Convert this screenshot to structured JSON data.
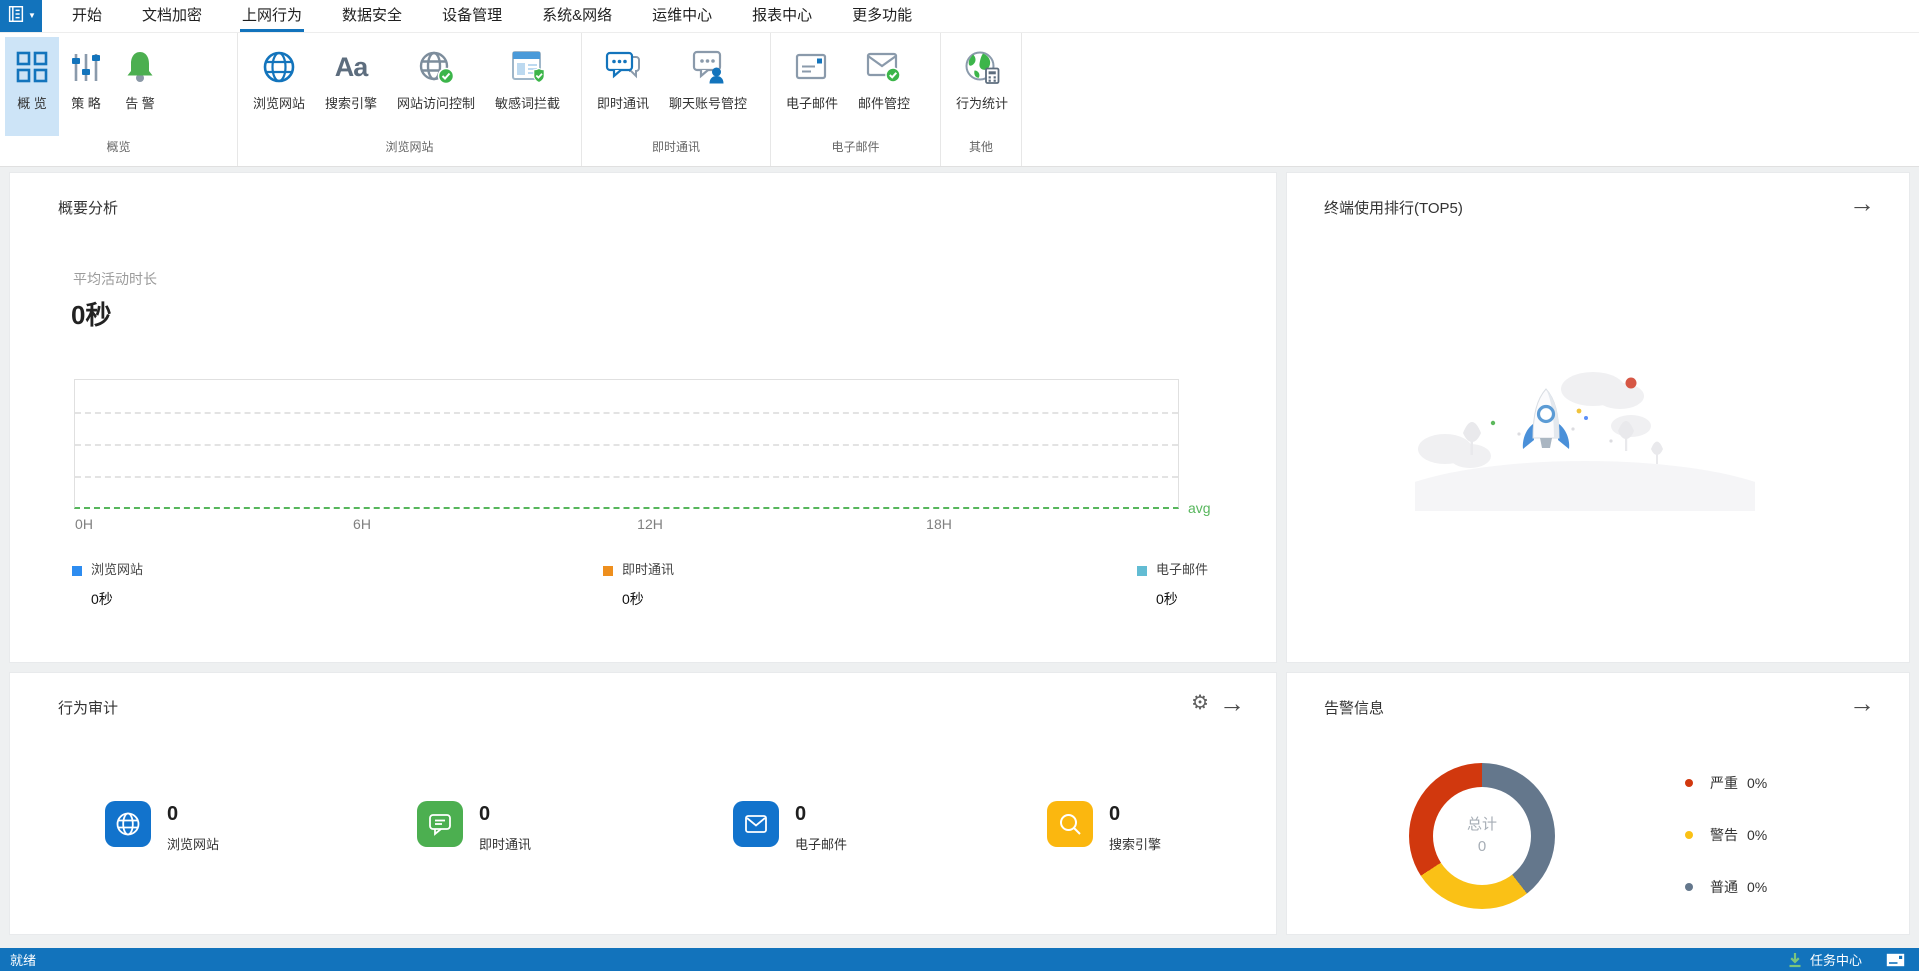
{
  "window": {
    "menu": [
      "开始",
      "文档加密",
      "上网行为",
      "数据安全",
      "设备管理",
      "系统&网络",
      "运维中心",
      "报表中心",
      "更多功能"
    ],
    "active_menu": "上网行为"
  },
  "ribbon": {
    "groups": [
      {
        "label": "概览",
        "buttons": [
          {
            "label": "概 览",
            "icon": "grid-icon",
            "selected": true
          },
          {
            "label": "策 略",
            "icon": "sliders-icon"
          },
          {
            "label": "告 警",
            "icon": "bell-icon"
          }
        ]
      },
      {
        "label": "浏览网站",
        "buttons": [
          {
            "label": "浏览网站",
            "icon": "globe-icon"
          },
          {
            "label": "搜索引擎",
            "icon": "aa-icon"
          },
          {
            "label": "网站访问控制",
            "icon": "globe-check-icon"
          },
          {
            "label": "敏感词拦截",
            "icon": "document-shield-icon"
          }
        ]
      },
      {
        "label": "即时通讯",
        "buttons": [
          {
            "label": "即时通讯",
            "icon": "chat-icon"
          },
          {
            "label": "聊天账号管控",
            "icon": "chat-person-icon"
          }
        ]
      },
      {
        "label": "电子邮件",
        "buttons": [
          {
            "label": "电子邮件",
            "icon": "mail-icon"
          },
          {
            "label": "邮件管控",
            "icon": "mail-shield-icon"
          }
        ]
      },
      {
        "label": "其他",
        "buttons": [
          {
            "label": "行为统计",
            "icon": "globe-calculator-icon"
          }
        ]
      }
    ]
  },
  "overview": {
    "title": "概要分析",
    "metric_label": "平均活动时长",
    "metric_value": "0秒",
    "x_labels": [
      "0H",
      "6H",
      "12H",
      "18H"
    ],
    "avg_label": "avg",
    "legend": [
      {
        "label": "浏览网站",
        "value": "0秒",
        "color": "#2d8cf0"
      },
      {
        "label": "即时通讯",
        "value": "0秒",
        "color": "#ee8f1e"
      },
      {
        "label": "电子邮件",
        "value": "0秒",
        "color": "#62bcd3"
      }
    ]
  },
  "top5": {
    "title": "终端使用排行(TOP5)",
    "arrow": "→"
  },
  "audit": {
    "title": "行为审计",
    "gear": "⚙",
    "arrow": "→",
    "items": [
      {
        "value": "0",
        "label": "浏览网站",
        "color": "#1273cc",
        "icon": "globe-icon"
      },
      {
        "value": "0",
        "label": "即时通讯",
        "color": "#4caf50",
        "icon": "chat-icon"
      },
      {
        "value": "0",
        "label": "电子邮件",
        "color": "#1273cc",
        "icon": "mail-icon"
      },
      {
        "value": "0",
        "label": "搜索引擎",
        "color": "#fbb70f",
        "icon": "search-icon"
      }
    ]
  },
  "alerts": {
    "title": "告警信息",
    "arrow": "→",
    "center_label": "总计",
    "center_value": "0"
  },
  "statusbar": {
    "left": "就绪",
    "task_center": "任务中心"
  },
  "chart_data": [
    {
      "type": "line",
      "title": "概要分析 - 平均活动时长",
      "x_axis_labels": [
        "0H",
        "6H",
        "12H",
        "18H"
      ],
      "x_range_hours": [
        0,
        23
      ],
      "series": [
        {
          "name": "浏览网站",
          "values": [
            0,
            0,
            0,
            0
          ],
          "color": "#2d8cf0"
        },
        {
          "name": "即时通讯",
          "values": [
            0,
            0,
            0,
            0
          ],
          "color": "#ee8f1e"
        },
        {
          "name": "电子邮件",
          "values": [
            0,
            0,
            0,
            0
          ],
          "color": "#62bcd3"
        }
      ],
      "avg_line": {
        "label": "avg",
        "value": 0,
        "color": "#57b65c",
        "style": "dashed"
      },
      "grid": "dashed-horizontal",
      "legend_position": "bottom"
    },
    {
      "type": "pie",
      "donut": true,
      "title": "告警信息",
      "center_label": "总计",
      "center_value": 0,
      "slices": [
        {
          "label": "严重",
          "percent_label": "0%",
          "color": "#d1380e",
          "display_angle_deg": 123
        },
        {
          "label": "警告",
          "percent_label": "0%",
          "color": "#fac116",
          "display_angle_deg": 95
        },
        {
          "label": "普通",
          "percent_label": "0%",
          "color": "#64778c",
          "display_angle_deg": 142
        }
      ],
      "legend_position": "right"
    }
  ]
}
